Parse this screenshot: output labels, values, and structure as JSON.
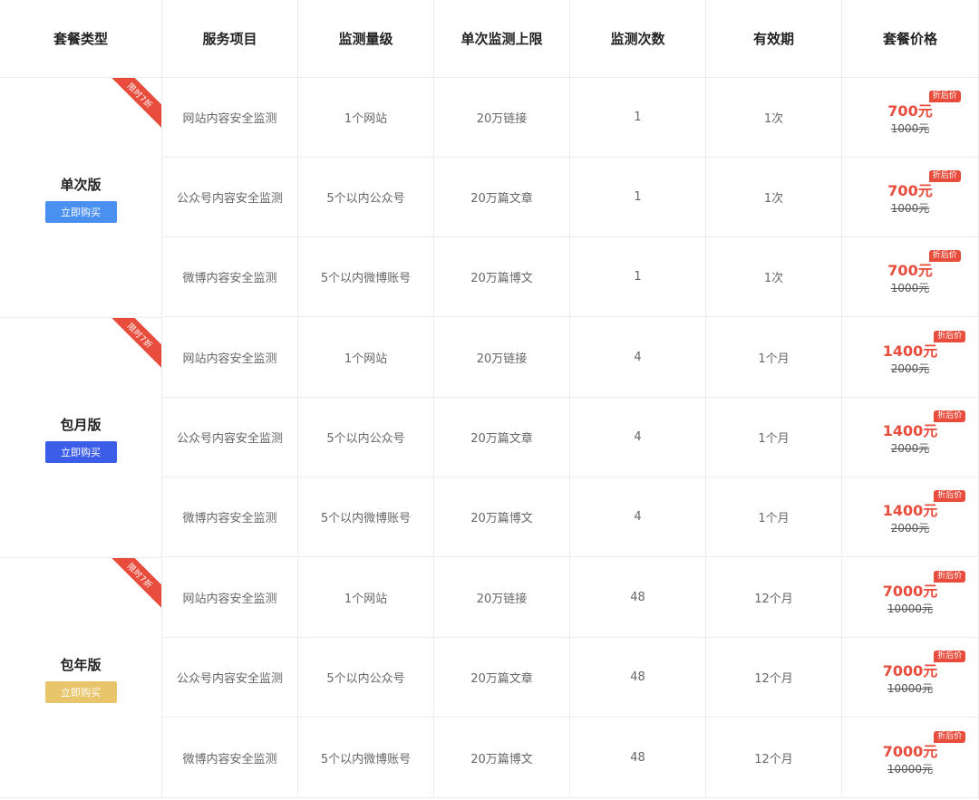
{
  "headers": [
    "套餐类型",
    "服务项目",
    "监测量级",
    "单次监测上限",
    "监测次数",
    "有效期",
    "套餐价格"
  ],
  "colors": {
    "accent_red": "#e74c3c",
    "btn_single": "#4a90f0",
    "btn_monthly": "#3b5de7",
    "btn_yearly": "#e8c46a",
    "ribbon": "#e74c3c"
  },
  "plans": [
    {
      "name": "单次版",
      "button": "立即购买",
      "ribbon": "限时7折",
      "rows": [
        {
          "service": "网站内容安全监测",
          "scale": "1个网站",
          "limit": "20万链接",
          "count": "1",
          "validity": "1次",
          "tag": "折后价",
          "price": "700元",
          "original": "1000元"
        },
        {
          "service": "公众号内容安全监测",
          "scale": "5个以内公众号",
          "limit": "20万篇文章",
          "count": "1",
          "validity": "1次",
          "tag": "折后价",
          "price": "700元",
          "original": "1000元"
        },
        {
          "service": "微博内容安全监测",
          "scale": "5个以内微博账号",
          "limit": "20万篇博文",
          "count": "1",
          "validity": "1次",
          "tag": "折后价",
          "price": "700元",
          "original": "1000元"
        }
      ]
    },
    {
      "name": "包月版",
      "button": "立即购买",
      "ribbon": "限时7折",
      "rows": [
        {
          "service": "网站内容安全监测",
          "scale": "1个网站",
          "limit": "20万链接",
          "count": "4",
          "validity": "1个月",
          "tag": "折后价",
          "price": "1400元",
          "original": "2000元"
        },
        {
          "service": "公众号内容安全监测",
          "scale": "5个以内公众号",
          "limit": "20万篇文章",
          "count": "4",
          "validity": "1个月",
          "tag": "折后价",
          "price": "1400元",
          "original": "2000元"
        },
        {
          "service": "微博内容安全监测",
          "scale": "5个以内微博账号",
          "limit": "20万篇博文",
          "count": "4",
          "validity": "1个月",
          "tag": "折后价",
          "price": "1400元",
          "original": "2000元"
        }
      ]
    },
    {
      "name": "包年版",
      "button": "立即购买",
      "ribbon": "限时7折",
      "rows": [
        {
          "service": "网站内容安全监测",
          "scale": "1个网站",
          "limit": "20万链接",
          "count": "48",
          "validity": "12个月",
          "tag": "折后价",
          "price": "7000元",
          "original": "10000元"
        },
        {
          "service": "公众号内容安全监测",
          "scale": "5个以内公众号",
          "limit": "20万篇文章",
          "count": "48",
          "validity": "12个月",
          "tag": "折后价",
          "price": "7000元",
          "original": "10000元"
        },
        {
          "service": "微博内容安全监测",
          "scale": "5个以内微博账号",
          "limit": "20万篇博文",
          "count": "48",
          "validity": "12个月",
          "tag": "折后价",
          "price": "7000元",
          "original": "10000元"
        }
      ]
    }
  ]
}
